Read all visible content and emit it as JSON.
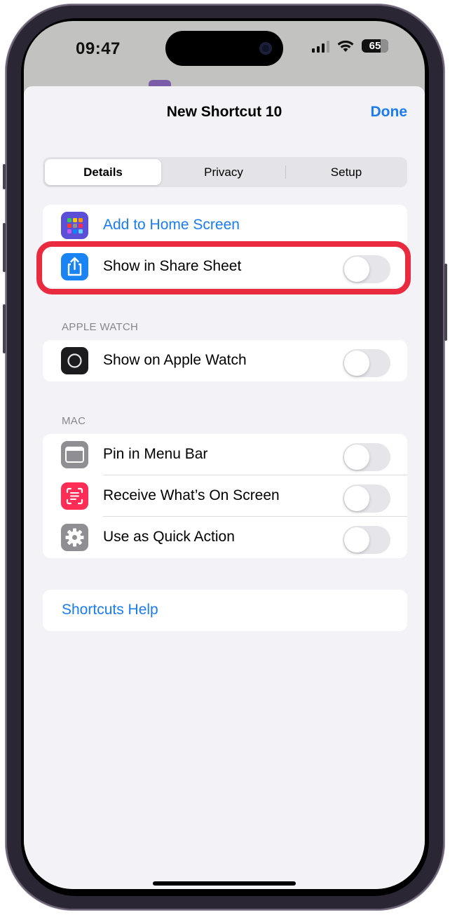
{
  "status_bar": {
    "time": "09:47",
    "battery": "65",
    "icons": [
      "cellular-signal-icon",
      "wifi-icon",
      "battery-icon"
    ]
  },
  "nav": {
    "title": "New Shortcut 10",
    "done_label": "Done"
  },
  "segments": [
    {
      "label": "Details",
      "selected": true
    },
    {
      "label": "Privacy",
      "selected": false
    },
    {
      "label": "Setup",
      "selected": false
    }
  ],
  "top_group": [
    {
      "label": "Add to Home Screen",
      "icon": "home-screen-grid-icon",
      "type": "link"
    },
    {
      "label": "Show in Share Sheet",
      "icon": "share-icon",
      "type": "toggle",
      "on": false,
      "highlighted": true
    }
  ],
  "apple_watch": {
    "header": "APPLE WATCH",
    "items": [
      {
        "label": "Show on Apple Watch",
        "icon": "apple-watch-icon",
        "on": false
      }
    ]
  },
  "mac": {
    "header": "MAC",
    "items": [
      {
        "label": "Pin in Menu Bar",
        "icon": "menu-bar-window-icon",
        "on": false
      },
      {
        "label": "Receive What’s On Screen",
        "icon": "screen-capture-text-icon",
        "on": false
      },
      {
        "label": "Use as Quick Action",
        "icon": "gear-icon",
        "on": false
      }
    ]
  },
  "help": {
    "label": "Shortcuts Help"
  },
  "colors": {
    "accent": "#1a7cf0",
    "highlight": "#ea2a3e",
    "share_icon_bg": "#1a84f5",
    "home_icon_bg": "#5a4fd6",
    "screen_icon_bg": "#ff2d55",
    "gray_icon_bg": "#8e8e93"
  }
}
